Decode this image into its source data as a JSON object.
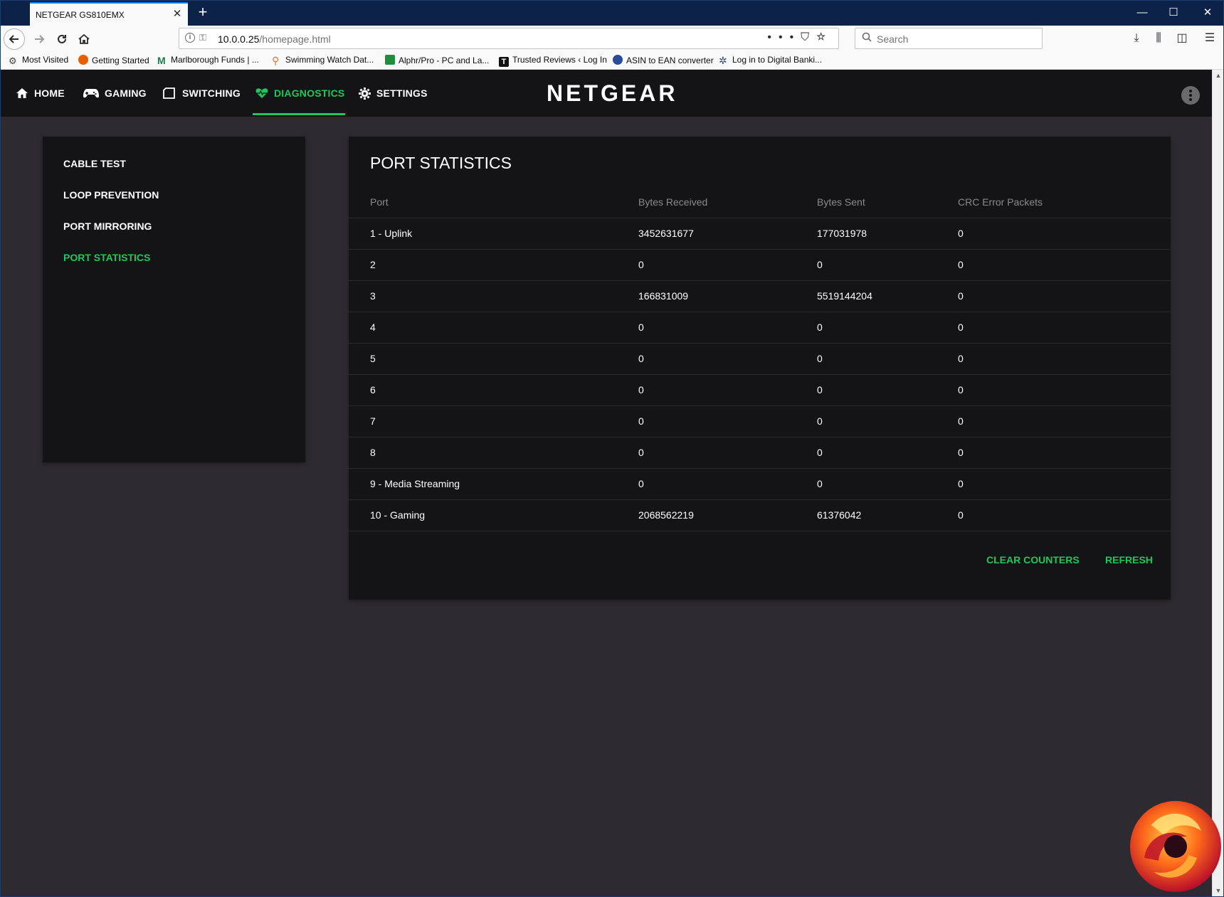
{
  "browser": {
    "tab_title": "NETGEAR GS810EMX",
    "tab_close": "✕",
    "new_tab": "+",
    "window_controls": {
      "minimize": "—",
      "maximize": "☐",
      "close": "✕"
    },
    "url_host": "10.0.0.25",
    "url_path": "/homepage.html",
    "search_placeholder": "Search",
    "bookmarks": [
      {
        "label": "Most Visited",
        "icon_color": "#5a5a5a"
      },
      {
        "label": "Getting Started",
        "icon_color": "#e66000"
      },
      {
        "label": "Marlborough Funds | ...",
        "icon_color": "#1f7a4d"
      },
      {
        "label": "Swimming Watch Dat...",
        "icon_color": "#f07028"
      },
      {
        "label": "Alphr/Pro - PC and La...",
        "icon_color": "#1e8e3e"
      },
      {
        "label": "Trusted Reviews ‹ Log In",
        "icon_color": "#111111"
      },
      {
        "label": "ASIN to EAN converter",
        "icon_color": "#2b4c9a"
      },
      {
        "label": "Log in to Digital Banki...",
        "icon_color": "#1b4f9c"
      }
    ]
  },
  "app": {
    "brand": "NETGEAR",
    "accent_color": "#1fc75b",
    "nav": {
      "home": "HOME",
      "gaming": "GAMING",
      "switching": "SWITCHING",
      "diagnostics": "DIAGNOSTICS",
      "settings": "SETTINGS"
    },
    "active_nav": "DIAGNOSTICS",
    "sidebar": {
      "items": [
        "CABLE TEST",
        "LOOP PREVENTION",
        "PORT MIRRORING",
        "PORT STATISTICS"
      ],
      "active": "PORT STATISTICS"
    },
    "panel": {
      "title": "PORT STATISTICS",
      "columns": [
        "Port",
        "Bytes Received",
        "Bytes Sent",
        "CRC Error Packets"
      ],
      "rows": [
        [
          "1 - Uplink",
          "3452631677",
          "177031978",
          "0"
        ],
        [
          "2",
          "0",
          "0",
          "0"
        ],
        [
          "3",
          "166831009",
          "5519144204",
          "0"
        ],
        [
          "4",
          "0",
          "0",
          "0"
        ],
        [
          "5",
          "0",
          "0",
          "0"
        ],
        [
          "6",
          "0",
          "0",
          "0"
        ],
        [
          "7",
          "0",
          "0",
          "0"
        ],
        [
          "8",
          "0",
          "0",
          "0"
        ],
        [
          "9 - Media Streaming",
          "0",
          "0",
          "0"
        ],
        [
          "10 - Gaming",
          "2068562219",
          "61376042",
          "0"
        ]
      ],
      "buttons": {
        "clear": "CLEAR COUNTERS",
        "refresh": "REFRESH"
      }
    }
  }
}
